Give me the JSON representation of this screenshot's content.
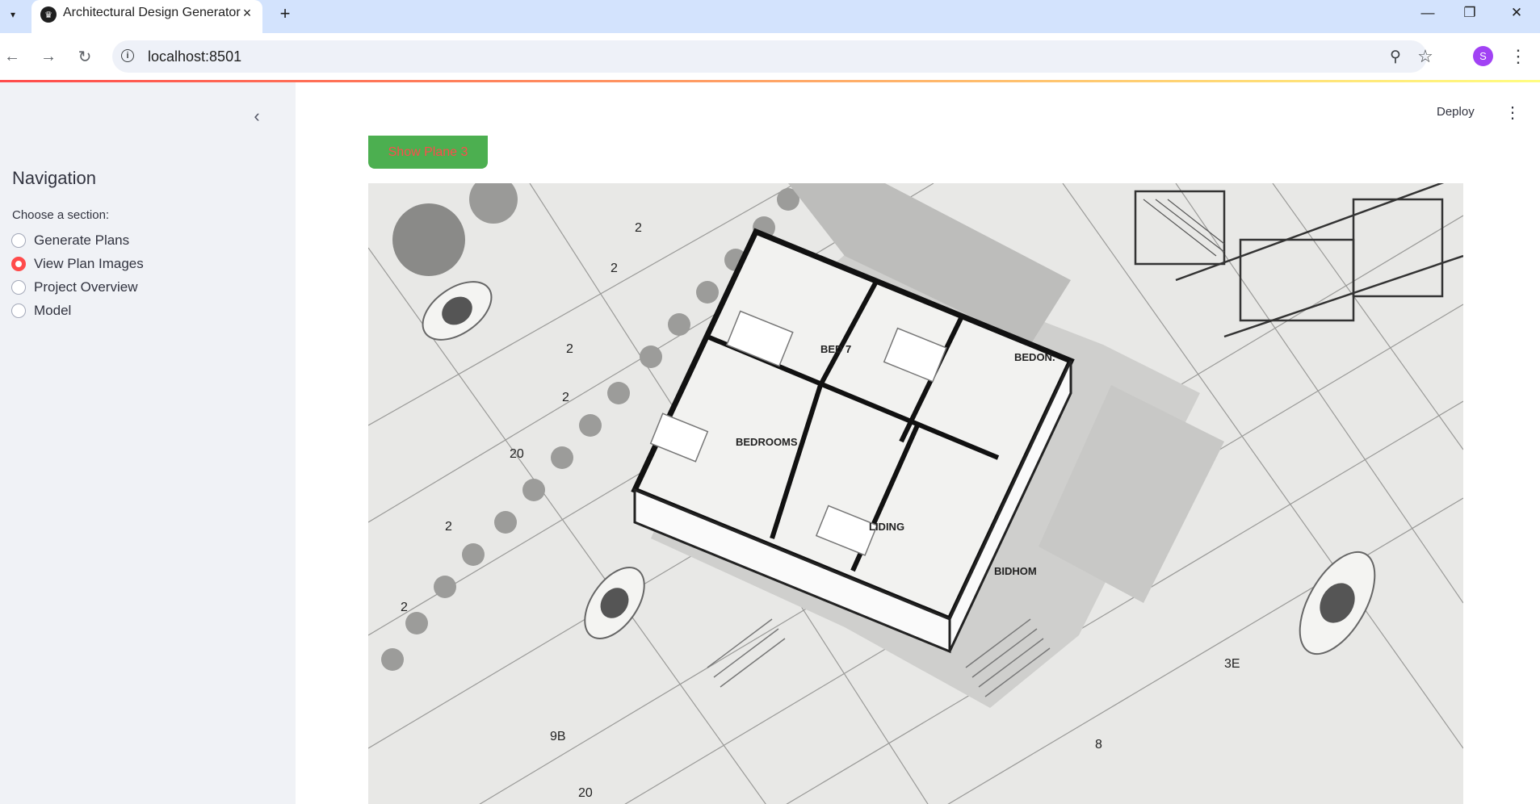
{
  "browser": {
    "tab_title": "Architectural Design Generator",
    "url": "localhost:8501",
    "profile_initial": "S",
    "icons": {
      "tab_menu": "chevron-down-icon",
      "favicon": "streamlit-crown-icon",
      "tab_close": "close-icon",
      "new_tab": "plus-icon",
      "back": "arrow-left-icon",
      "forward": "arrow-right-icon",
      "reload": "reload-icon",
      "site_info": "info-icon",
      "zoom": "zoom-icon",
      "bookmark": "star-icon",
      "menu": "kebab-icon",
      "minimize": "minimize-icon",
      "restore": "restore-icon",
      "close_window": "close-icon"
    }
  },
  "sidebar": {
    "title": "Navigation",
    "radio_label": "Choose a section:",
    "options": [
      {
        "label": "Generate Plans",
        "selected": false
      },
      {
        "label": "View Plan Images",
        "selected": true
      },
      {
        "label": "Project Overview",
        "selected": false
      },
      {
        "label": "Model",
        "selected": false
      }
    ]
  },
  "main": {
    "deploy_label": "Deploy",
    "show_plan_button": "Show Plane 3",
    "image": {
      "room_labels": [
        "BED 7",
        "BEDON.",
        "BEDROOMS",
        "LIDING",
        "BIDHOM"
      ]
    }
  },
  "colors": {
    "accent": "#ff4b4b",
    "button_bg": "#4caf50",
    "sidebar_bg": "#f0f2f6",
    "tabstrip_bg": "#d3e3fd"
  }
}
